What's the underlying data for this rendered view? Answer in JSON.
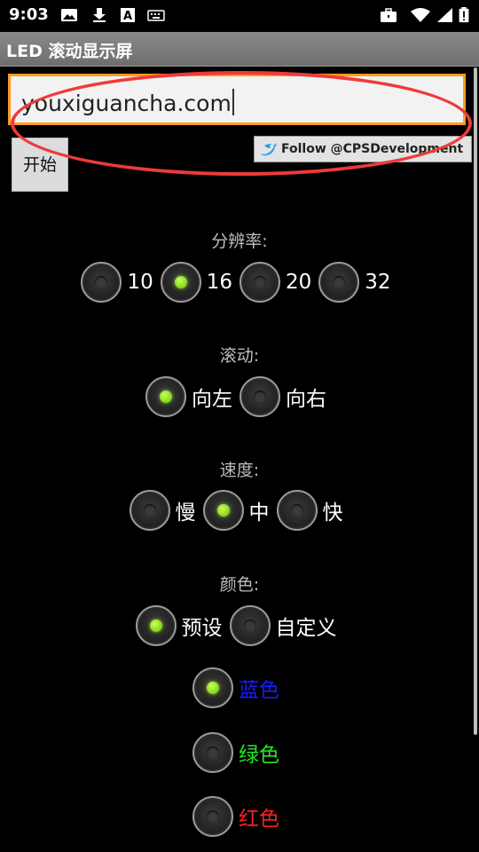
{
  "status_bar": {
    "time": "9:03",
    "left_icons": [
      "image-icon",
      "download-icon",
      "font-a-icon",
      "keyboard-icon"
    ],
    "right_icons": [
      "briefcase-icon",
      "wifi-icon",
      "signal-icon",
      "battery-icon"
    ]
  },
  "app": {
    "title": "LED 滚动显示屏"
  },
  "input": {
    "value": "youxiguancha.com"
  },
  "follow_badge": {
    "text": "Follow @CPSDevelopment"
  },
  "start_button": {
    "label": "开始"
  },
  "resolution": {
    "label": "分辨率:",
    "options": [
      {
        "label": "10",
        "checked": false
      },
      {
        "label": "16",
        "checked": true
      },
      {
        "label": "20",
        "checked": false
      },
      {
        "label": "32",
        "checked": false
      }
    ]
  },
  "scroll": {
    "label": "滚动:",
    "options": [
      {
        "label": "向左",
        "checked": true
      },
      {
        "label": "向右",
        "checked": false
      }
    ]
  },
  "speed": {
    "label": "速度:",
    "options": [
      {
        "label": "慢",
        "checked": false
      },
      {
        "label": "中",
        "checked": true
      },
      {
        "label": "快",
        "checked": false
      }
    ]
  },
  "color": {
    "label": "颜色:",
    "options": [
      {
        "label": "预设",
        "checked": true
      },
      {
        "label": "自定义",
        "checked": false
      }
    ],
    "presets": [
      {
        "label": "蓝色",
        "checked": true,
        "color": "#1a1aff"
      },
      {
        "label": "绿色",
        "checked": false,
        "color": "#22e622"
      },
      {
        "label": "红色",
        "checked": false,
        "color": "#ff2020"
      }
    ]
  },
  "colors": {
    "accent_border": "#ff9a20",
    "annotation": "#ee3a3a",
    "radio_checked": "#86d21e"
  }
}
